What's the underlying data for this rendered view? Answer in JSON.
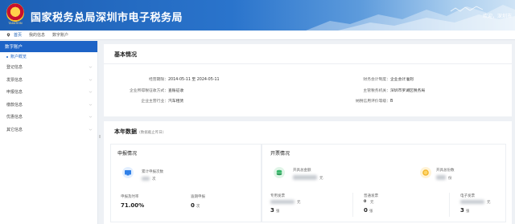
{
  "header": {
    "emblem_caption": "TAXATION",
    "title": "国家税务总局深圳市电子税务局",
    "user_text": "欢迎，深圳市"
  },
  "breadcrumb": [
    "首页",
    "我的信息",
    "数字账户"
  ],
  "sidebar": {
    "heading": "数字账户",
    "active_sub": "账户概览",
    "items": [
      {
        "label": "登记信息"
      },
      {
        "label": "发票信息"
      },
      {
        "label": "申报信息"
      },
      {
        "label": "缴款信息"
      },
      {
        "label": "优惠信息"
      },
      {
        "label": "其它信息"
      }
    ],
    "collapse_glyph": "‖"
  },
  "basic": {
    "title": "基本情况",
    "left": [
      {
        "key": "经营期限：",
        "value": "2014-05-11 至 2024-05-11"
      },
      {
        "key": "企业所得税征收方式：",
        "value": "查账征收"
      },
      {
        "key": "企业主营行业：",
        "value": "汽车租赁"
      }
    ],
    "right": [
      {
        "key": "财务会计制度：",
        "value": "企业会计准则"
      },
      {
        "key": "主管税务机关：",
        "value": "深圳市罗湖区税务局"
      },
      {
        "key": "纳税信用评价等级：",
        "value": "B"
      }
    ]
  },
  "year": {
    "title": "本年数据",
    "note": "(数据截止昨日)",
    "declare": {
      "title": "申报情况",
      "count_label": "累计申报次数",
      "count_unit": "次",
      "ontime_label": "申报及时率",
      "ontime_value": "71.00%",
      "late_label": "逾期申报",
      "late_value": "0",
      "late_unit": "次"
    },
    "invoice": {
      "title": "开票情况",
      "total_label": "开具总金额",
      "total_unit": "元",
      "count_label": "开具总份数",
      "count_unit": "份",
      "columns": [
        {
          "label": "专用发票",
          "value": "3",
          "unit": "张",
          "amount_unit": "元"
        },
        {
          "label": "普通发票",
          "value": "0",
          "unit": "张",
          "amount_unit": "元"
        },
        {
          "label": "电子发票",
          "value": "3",
          "unit": "张",
          "amount_unit": "元"
        }
      ]
    }
  },
  "colors": {
    "brand": "#1d63c6",
    "declare_icon": "#2f80e8",
    "invoice_total_icon": "#38b86a",
    "invoice_count_icon": "#f2b428"
  },
  "icons": [
    "location-pin-icon",
    "chevron-down-icon",
    "monitor-icon",
    "coins-icon",
    "coin-icon"
  ]
}
